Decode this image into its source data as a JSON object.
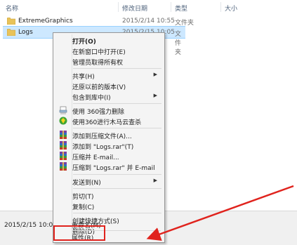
{
  "header": {
    "col_name": "名称",
    "col_date": "修改日期",
    "col_type": "类型",
    "col_size": "大小"
  },
  "files": [
    {
      "name": "ExtremeGraphics",
      "date": "2015/2/14 10:55",
      "type": "文件夹"
    },
    {
      "name": "Logs",
      "date": "2015/2/15 10:05",
      "type": "文件夹"
    }
  ],
  "status": {
    "date": "2015/2/15 10:05"
  },
  "menu": {
    "open": "打开(O)",
    "open_new": "在新窗口中打开(E)",
    "admin": "管理员取得所有权",
    "share": "共享(H)",
    "restore": "还原以前的版本(V)",
    "include": "包含到库中(I)",
    "shred360": "使用 360强力删除",
    "scan360": "使用360进行木马云查杀",
    "add_archive": "添加到压缩文件(A)...",
    "add_rar": "添加到 \"Logs.rar\"(T)",
    "compress_email": "压缩并 E-mail...",
    "compress_rar_email": "压缩到 \"Logs.rar\" 并 E-mail",
    "send_to": "发送到(N)",
    "cut": "剪切(T)",
    "copy": "复制(C)",
    "shortcut": "创建快捷方式(S)",
    "delete": "删除(D)",
    "rename": "重命名(M)",
    "properties": "属性(R)"
  },
  "colors": {
    "highlight_box": "#e0231d",
    "selection": "#cde8ff"
  }
}
